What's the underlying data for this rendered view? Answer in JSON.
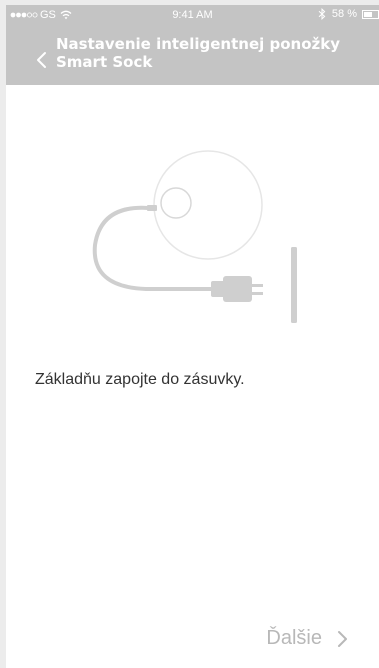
{
  "status_bar": {
    "carrier": "GS",
    "time": "9:41 AM",
    "battery_percent": "58 %",
    "battery_level": 0.58
  },
  "header": {
    "title": "Nastavenie inteligentnej ponožky Smart Sock",
    "back_icon": "chevron-left-icon"
  },
  "main": {
    "illustration": "base-station-plug-icon",
    "instruction": "Základňu zapojte do zásuvky."
  },
  "footer": {
    "next_label": "Ďalšie",
    "next_icon": "chevron-right-icon"
  },
  "colors": {
    "header_bg": "#c4c4c4",
    "illustration_gray": "#cfcfcf",
    "next_text": "#b8b8b8"
  }
}
